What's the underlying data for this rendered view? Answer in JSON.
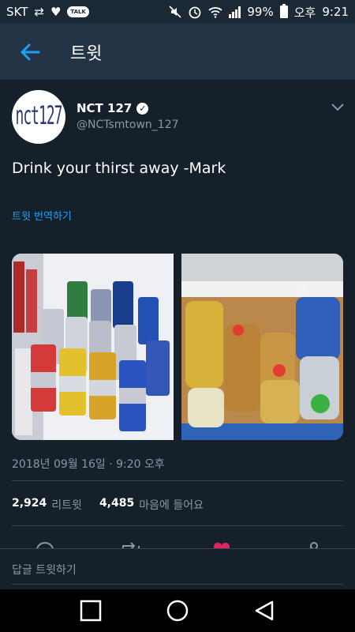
{
  "status_bar": {
    "carrier": "SKT",
    "battery": "99%",
    "ampm": "오후",
    "time": "9:21",
    "talk_badge": "TALK",
    "icons": [
      "retweet-icon",
      "heart-icon",
      "kakaotalk-icon",
      "mute-icon",
      "alarm-icon",
      "wifi-icon",
      "signal-icon",
      "battery-icon"
    ]
  },
  "app_bar": {
    "title": "트윗",
    "back_icon": "back-arrow-icon"
  },
  "tweet": {
    "display_name": "NCT 127",
    "handle": "@NCTsmtown_127",
    "avatar_text": "nct127",
    "text": "Drink your thirst away -Mark",
    "translate": "트윗 번역하기",
    "timestamp": "2018년 09월 16일 · 9:20 오후",
    "retweets_count": "2,924",
    "retweets_label": "리트윗",
    "likes_count": "4,485",
    "likes_label": "마음에 들어요"
  },
  "reply": {
    "placeholder": "답글 트윗하기"
  },
  "nav": {
    "icons": [
      "recent-apps-icon",
      "home-icon",
      "back-icon"
    ]
  },
  "colors": {
    "background": "#15202b",
    "app_bar": "#243447",
    "link": "#1da1f2",
    "secondary_text": "#8899a6",
    "like": "#e0245e"
  }
}
